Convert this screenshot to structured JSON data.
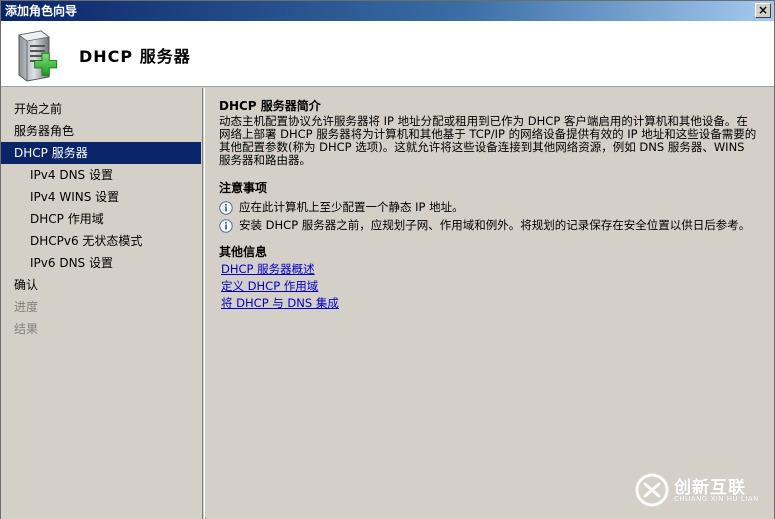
{
  "window": {
    "title": "添加角色向导",
    "close_glyph": "×"
  },
  "header": {
    "title": "DHCP 服务器",
    "icon": "server-add-icon"
  },
  "sidebar": {
    "items": [
      {
        "label": "开始之前",
        "level": 0,
        "state": "normal"
      },
      {
        "label": "服务器角色",
        "level": 0,
        "state": "normal"
      },
      {
        "label": "DHCP 服务器",
        "level": 0,
        "state": "active"
      },
      {
        "label": "IPv4 DNS 设置",
        "level": 1,
        "state": "normal"
      },
      {
        "label": "IPv4 WINS 设置",
        "level": 1,
        "state": "normal"
      },
      {
        "label": "DHCP 作用域",
        "level": 1,
        "state": "normal"
      },
      {
        "label": "DHCPv6 无状态模式",
        "level": 1,
        "state": "normal"
      },
      {
        "label": "IPv6 DNS 设置",
        "level": 1,
        "state": "normal"
      },
      {
        "label": "确认",
        "level": 0,
        "state": "normal"
      },
      {
        "label": "进度",
        "level": 0,
        "state": "disabled"
      },
      {
        "label": "结果",
        "level": 0,
        "state": "disabled"
      }
    ]
  },
  "main": {
    "intro_title": "DHCP 服务器简介",
    "intro_text": "动态主机配置协议允许服务器将 IP 地址分配或租用到已作为 DHCP 客户端启用的计算机和其他设备。在网络上部署 DHCP 服务器将为计算机和其他基于 TCP/IP 的网络设备提供有效的 IP 地址和这些设备需要的其他配置参数(称为 DHCP 选项)。这就允许将这些设备连接到其他网络资源，例如 DNS 服务器、WINS 服务器和路由器。",
    "notes_title": "注意事项",
    "notes": [
      "应在此计算机上至少配置一个静态 IP 地址。",
      "安装 DHCP 服务器之前，应规划子网、作用域和例外。将规划的记录保存在安全位置以供日后参考。"
    ],
    "other_title": "其他信息",
    "links": [
      "DHCP 服务器概述",
      "定义 DHCP 作用域",
      "将 DHCP 与 DNS 集成"
    ]
  },
  "watermark": {
    "text": "创新互联",
    "subtext": "CHUANG XIN HU LIAN"
  },
  "colors": {
    "accent": "#0a246a",
    "link": "#0000cc",
    "background": "#d4d0c8"
  }
}
